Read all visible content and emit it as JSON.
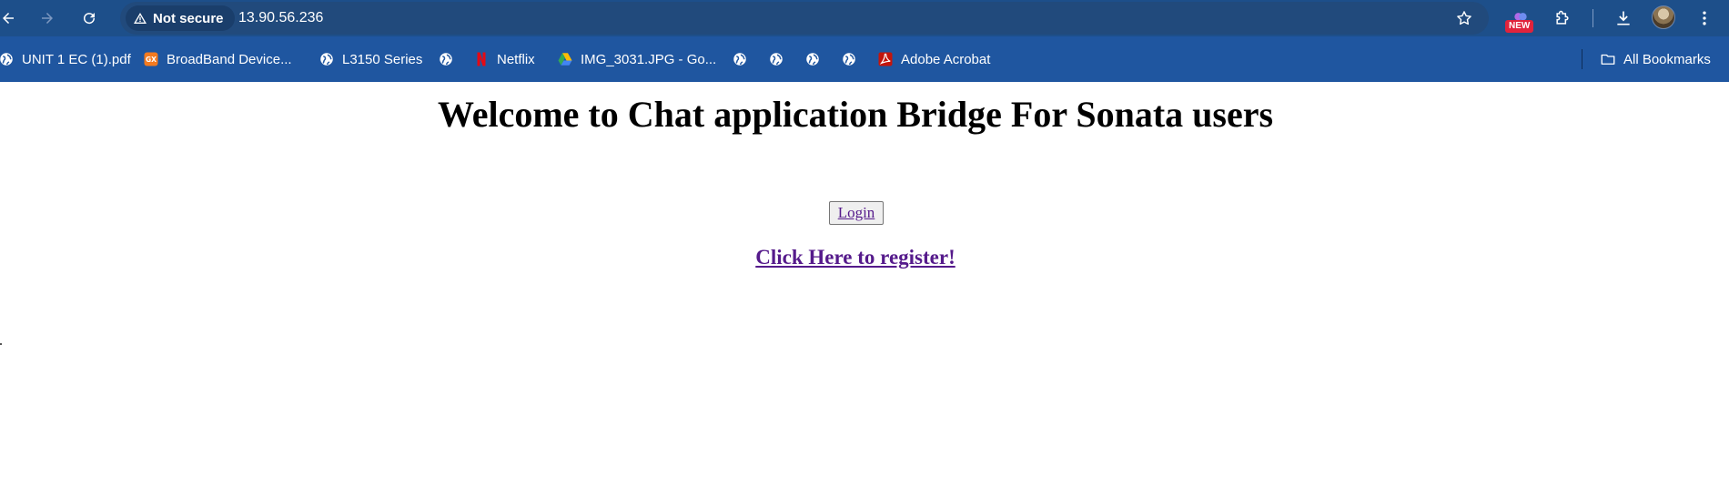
{
  "browser": {
    "security_label": "Not secure",
    "url": "13.90.56.236",
    "new_badge": "NEW",
    "accent_color": "#1d4f8a"
  },
  "bookmarks": {
    "items": [
      {
        "label": "UNIT 1 EC (1).pdf",
        "icon": "globe-icon"
      },
      {
        "label": "BroadBand Device...",
        "icon": "gx-icon"
      },
      {
        "label": "L3150 Series",
        "icon": "globe-icon"
      },
      {
        "label": "",
        "icon": "globe-icon"
      },
      {
        "label": "Netflix",
        "icon": "netflix-icon"
      },
      {
        "label": "IMG_3031.JPG - Go...",
        "icon": "google-drive-icon"
      },
      {
        "label": "",
        "icon": "globe-icon"
      },
      {
        "label": "",
        "icon": "globe-icon"
      },
      {
        "label": "",
        "icon": "globe-icon"
      },
      {
        "label": "",
        "icon": "globe-icon"
      },
      {
        "label": "Adobe Acrobat",
        "icon": "adobe-acrobat-icon"
      }
    ],
    "all_bookmarks_label": "All Bookmarks"
  },
  "page": {
    "title": "Welcome to Chat application Bridge For Sonata users",
    "login_label": "Login",
    "register_label": "Click Here to register!",
    "link_color": "#551a8b"
  }
}
